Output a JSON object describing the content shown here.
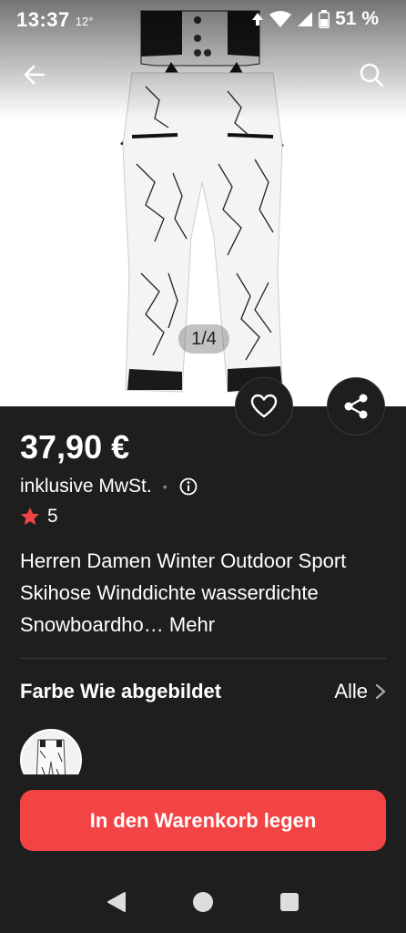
{
  "status_bar": {
    "time": "13:37",
    "temperature": "12°",
    "battery": "51 %"
  },
  "icons": {
    "back": "arrow-left-icon",
    "search": "search-icon",
    "wishlist": "heart-icon",
    "share": "share-icon",
    "info": "info-icon",
    "star": "star-icon",
    "chevron": "chevron-right-icon"
  },
  "gallery": {
    "pager": "1/4"
  },
  "product": {
    "price": "37,90 €",
    "vat_note": "inklusive MwSt.",
    "rating": "5",
    "title": "Herren Damen Winter Outdoor Sport Skihose Winddichte wasserdichte Snowboardho…",
    "more_label": "Mehr"
  },
  "color_section": {
    "label": "Farbe Wie abgebildet",
    "all_label": "Alle"
  },
  "actions": {
    "add_to_cart": "In den Warenkorb legen"
  },
  "colors": {
    "accent": "#f24444",
    "background": "#1e1e1e",
    "star": "#f24444"
  }
}
